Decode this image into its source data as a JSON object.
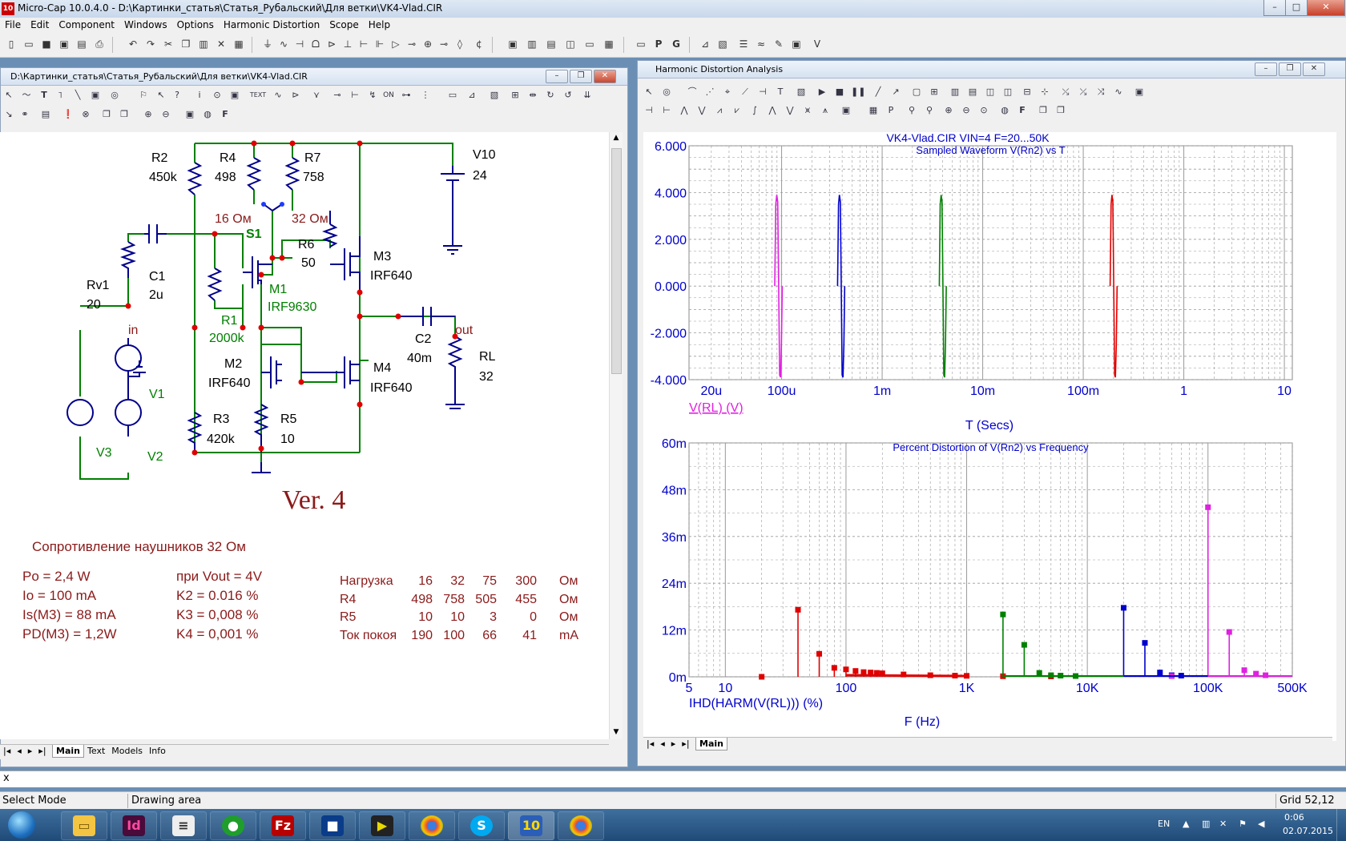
{
  "app": {
    "title": "Micro-Cap 10.0.4.0 - D:\\Картинки_статья\\Статья_Рубальский\\Для ветки\\VK4-Vlad.CIR",
    "icon": "10"
  },
  "menu": [
    "File",
    "Edit",
    "Component",
    "Windows",
    "Options",
    "Harmonic Distortion",
    "Scope",
    "Help"
  ],
  "schematic_window": {
    "title": "D:\\Картинки_статья\\Статья_Рубальский\\Для ветки\\VK4-Vlad.CIR",
    "tabs": [
      "Main",
      "Text",
      "Models",
      "Info"
    ],
    "active_tab": "Main",
    "components": {
      "R2": [
        "R2",
        "450k"
      ],
      "R4": [
        "R4",
        "498"
      ],
      "R7": [
        "R7",
        "758"
      ],
      "V10": [
        "V10",
        "24"
      ],
      "S1_left": "16 Ом",
      "S1_right": "32 Ом",
      "S1": "S1",
      "R6": [
        "R6",
        "50"
      ],
      "M3": [
        "M3",
        "IRF640"
      ],
      "M1": [
        "M1",
        "IRF9630"
      ],
      "Rv1": [
        "Rv1",
        "20"
      ],
      "C1": [
        "C1",
        "2u"
      ],
      "R1": [
        "R1",
        "2000k"
      ],
      "in": "in",
      "out": "out",
      "C2": [
        "C2",
        "40m"
      ],
      "RL": [
        "RL",
        "32"
      ],
      "V1": "V1",
      "M2": [
        "M2",
        "IRF640"
      ],
      "M4": [
        "M4",
        "IRF640"
      ],
      "R3": [
        "R3",
        "420k"
      ],
      "R5": [
        "R5",
        "10"
      ],
      "V3": "V3",
      "V2": "V2"
    },
    "version": "Ver. 4",
    "heading": "Сопротивление наушников 32 Ом",
    "left_params": [
      "Po = 2,4 W",
      "Io = 100 mA",
      "Is(M3) = 88 mA",
      "PD(M3) = 1,2W"
    ],
    "mid_params": [
      "при Vout = 4V",
      "K2 = 0.016 %",
      "K3 = 0,008 %",
      "K4 = 0,001 %"
    ],
    "table": [
      [
        "Нагрузка",
        "16",
        "32",
        "75",
        "300",
        "Ом"
      ],
      [
        "R4",
        "498",
        "758",
        "505",
        "455",
        "Ом"
      ],
      [
        "R5",
        "10",
        "10",
        "3",
        "0",
        "Ом"
      ],
      [
        "Ток покоя",
        "190",
        "100",
        "66",
        "41",
        "mA"
      ]
    ]
  },
  "analysis_window": {
    "title": "Harmonic Distortion Analysis",
    "heading": "VK4-Vlad.CIR VIN=4 F=20...50K",
    "tabs": [
      "Main"
    ]
  },
  "chart_data": [
    {
      "type": "line",
      "title": "Sampled Waveform  V(Rn2) vs T",
      "xlabel": "T (Secs)",
      "ylabel": "",
      "xscale": "log",
      "xlim": [
        1.2e-05,
        12
      ],
      "ylim": [
        -4,
        6
      ],
      "yticks": [
        "6.000",
        "4.000",
        "2.000",
        "0.000",
        "-2.000",
        "-4.000"
      ],
      "xticks": [
        "20u",
        "100u",
        "1m",
        "10m",
        "100m",
        "1",
        "10"
      ],
      "trace_label": "V(RL) (V)",
      "grid": true,
      "series": [
        {
          "color": "#e020e0",
          "x": [
            8.55e-05,
            8.75e-05,
            8.95e-05,
            9.15e-05,
            9.35e-05,
            9.55e-05,
            9.75e-05,
            9.95e-05,
            0.0001015
          ],
          "y": [
            0,
            3.5,
            3.9,
            3.6,
            0,
            -3.8,
            -3.9,
            -2.5,
            0
          ]
        },
        {
          "color": "#0000cc",
          "x": [
            0.00036,
            0.000368,
            0.000376,
            0.000384,
            0.000392,
            0.0004,
            0.000408,
            0.000416,
            0.000424
          ],
          "y": [
            0,
            3.5,
            3.9,
            3.6,
            0,
            -3.8,
            -3.9,
            -2.5,
            0
          ]
        },
        {
          "color": "#008000",
          "x": [
            0.0037,
            0.00378,
            0.00386,
            0.00394,
            0.00402,
            0.0041,
            0.00418,
            0.00426,
            0.00434
          ],
          "y": [
            0,
            3.5,
            3.9,
            3.6,
            0,
            -3.8,
            -3.9,
            -2.5,
            0
          ]
        },
        {
          "color": "#e00000",
          "x": [
            0.185,
            0.189,
            0.193,
            0.197,
            0.201,
            0.205,
            0.209,
            0.213,
            0.217
          ],
          "y": [
            0,
            3.5,
            3.9,
            3.6,
            0,
            -3.8,
            -3.9,
            -2.5,
            0
          ]
        }
      ]
    },
    {
      "type": "bar",
      "title": "Percent Distortion of V(Rn2) vs Frequency",
      "xlabel": "F (Hz)",
      "ylabel": "",
      "xscale": "log",
      "xlim": [
        5,
        500000
      ],
      "ylim": [
        0,
        0.06
      ],
      "yticks": [
        "60m",
        "48m",
        "36m",
        "24m",
        "12m",
        "0m"
      ],
      "xticks": [
        "5",
        "10",
        "100",
        "1K",
        "10K",
        "100K",
        "500K"
      ],
      "trace_label": "IHD(HARM(V(RL))) (%)",
      "grid": true,
      "series": [
        {
          "color": "#e00000",
          "x": [
            20,
            40,
            60,
            80,
            100,
            120,
            140,
            160,
            180,
            200,
            300,
            500,
            800,
            1000,
            2000,
            5000
          ],
          "values": [
            0,
            0.0172,
            0.0059,
            0.0023,
            0.0019,
            0.0015,
            0.0012,
            0.0011,
            0.001,
            0.0009,
            0.0006,
            0.0004,
            0.0003,
            0.00025,
            0.00015,
            0.0001
          ]
        },
        {
          "color": "#008000",
          "x": [
            2000,
            3000,
            4000,
            5000,
            6000,
            8000
          ],
          "values": [
            0.016,
            0.0082,
            0.001,
            0.0004,
            0.0003,
            0.0002
          ]
        },
        {
          "color": "#0000cc",
          "x": [
            20000,
            30000,
            40000,
            50000,
            60000
          ],
          "values": [
            0.0177,
            0.0087,
            0.0011,
            0.0004,
            0.0003
          ]
        },
        {
          "color": "#e020e0",
          "x": [
            50000,
            100000,
            150000,
            200000,
            250000,
            300000
          ],
          "values": [
            0.0002,
            0.0435,
            0.0115,
            0.0017,
            0.0008,
            0.0004
          ]
        }
      ]
    }
  ],
  "command_line": "x",
  "status": {
    "mode": "Select Mode",
    "area": "Drawing area",
    "grid": "Grid 52,12"
  },
  "taskbar": {
    "apps": [
      "start-orb",
      "explorer",
      "indesign",
      "notepad",
      "green-app",
      "filezilla",
      "app-blue",
      "video-app",
      "chrome",
      "skype",
      "microcap",
      "chrome-2"
    ],
    "lang": "EN",
    "time": "0:06",
    "date": "02.07.2015"
  }
}
